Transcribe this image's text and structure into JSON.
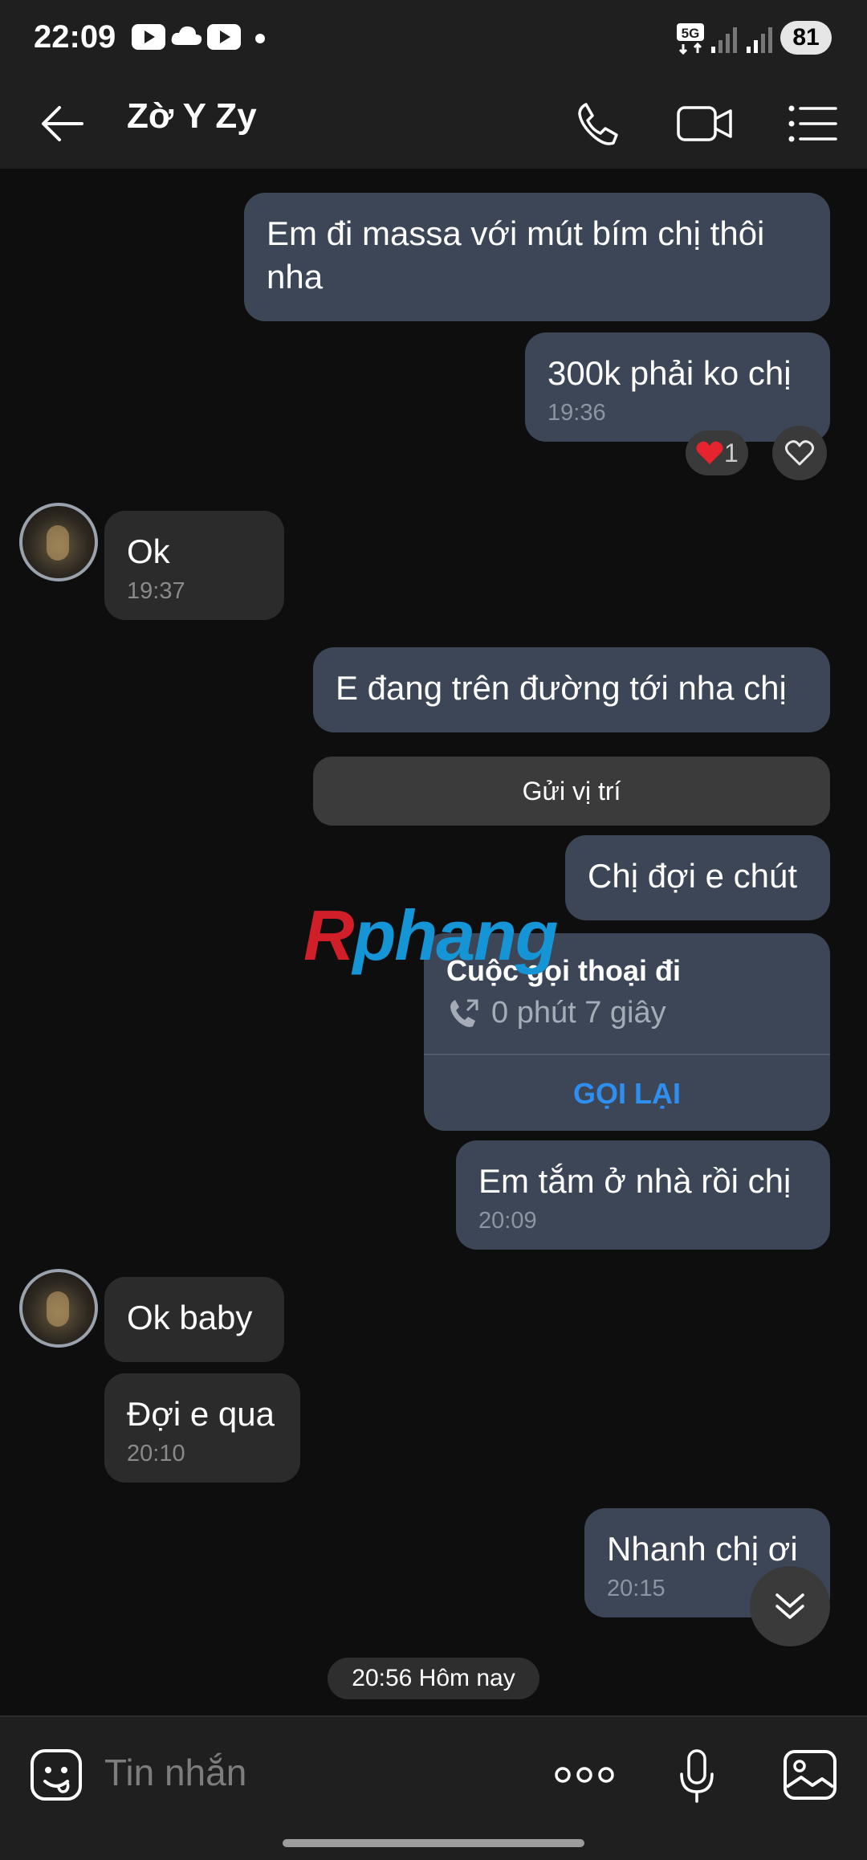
{
  "status_bar": {
    "time": "22:09",
    "network": "5G",
    "battery": "81",
    "icons": [
      "youtube-icon",
      "cloud-icon",
      "youtube-icon",
      "dot-icon",
      "signal-icon",
      "signal-icon"
    ]
  },
  "header": {
    "title": "Zờ Y Zy",
    "icons": [
      "back-arrow-icon",
      "phone-icon",
      "video-call-icon",
      "menu-list-icon"
    ]
  },
  "messages": {
    "m1": {
      "text": "Em đi massa với mút bím chị thôi nha"
    },
    "m2": {
      "text": "300k phải ko chị",
      "time": "19:36",
      "reaction_count": "1",
      "reaction": "heart"
    },
    "m3": {
      "text": "Ok",
      "time": "19:37"
    },
    "m4": {
      "text": "E đang trên đường tới nha chị"
    },
    "location": {
      "label": "Gửi vị trí"
    },
    "m5": {
      "text": "Chị đợi e chút"
    },
    "call": {
      "title": "Cuộc gọi thoại đi",
      "duration": "0 phút 7 giây",
      "action": "GỌI LẠI"
    },
    "m6": {
      "text": "Em tắm ở nhà rồi chị",
      "time": "20:09"
    },
    "m7": {
      "text": "Ok baby"
    },
    "m8": {
      "text": "Đợi e qua",
      "time": "20:10"
    },
    "m9": {
      "text": "Nhanh chị ơi",
      "time": "20:15"
    }
  },
  "watermark": {
    "first": "R",
    "rest": "phang"
  },
  "date_chip": "20:56 Hôm nay",
  "input": {
    "placeholder": "Tin nhắn",
    "icons": [
      "sticker-icon",
      "more-dots-icon",
      "microphone-icon",
      "gallery-icon"
    ]
  },
  "colors": {
    "background": "#0e0e0e",
    "bar": "#1f1f1f",
    "outgoing_bubble": "#3c4657",
    "incoming_bubble": "#2b2b2b",
    "accent_blue": "#2e8ff0",
    "heart_red": "#e5242f"
  }
}
